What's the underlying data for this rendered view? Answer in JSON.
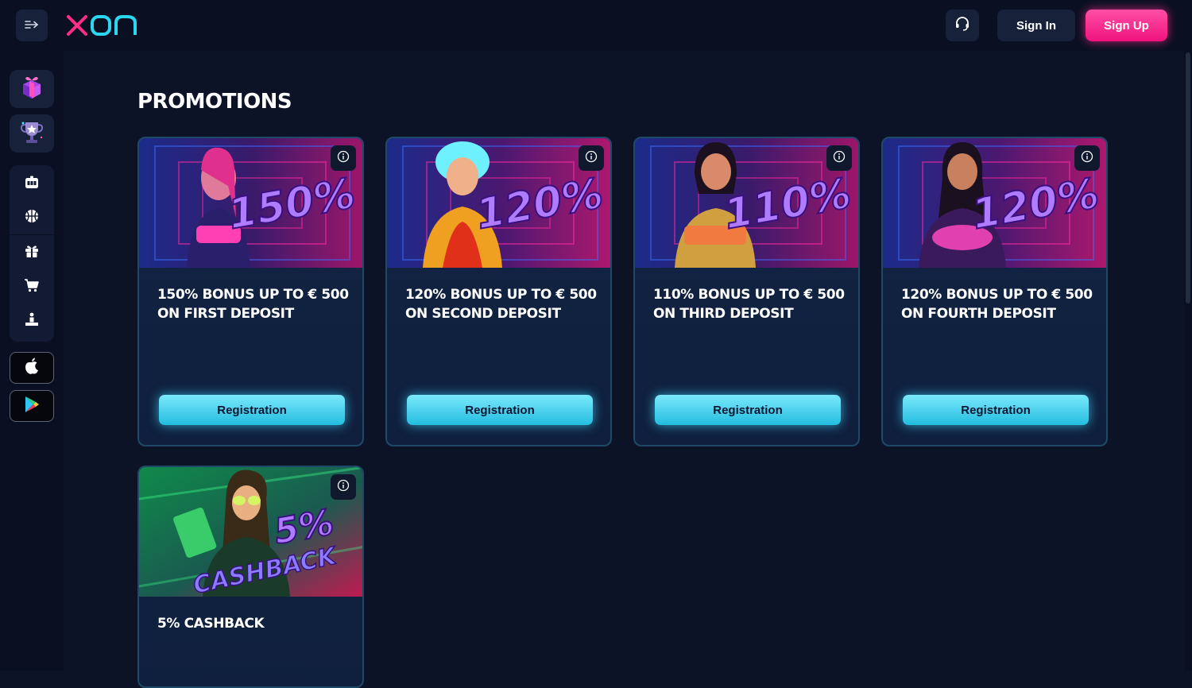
{
  "header": {
    "logo_text": "xon",
    "menu_icon": "expand-menu-icon",
    "support_icon": "headset-icon",
    "signin_label": "Sign In",
    "signup_label": "Sign Up"
  },
  "sidebar": {
    "featured": [
      {
        "name": "promotions",
        "icon": "gift-box-icon"
      },
      {
        "name": "tournaments",
        "icon": "trophy-icon"
      }
    ],
    "items": [
      {
        "name": "casino",
        "icon": "slot-machine-icon"
      },
      {
        "name": "sports",
        "icon": "basketball-icon"
      },
      {
        "name": "bonuses",
        "icon": "gift-icon"
      },
      {
        "name": "shop",
        "icon": "cart-icon"
      },
      {
        "name": "vip",
        "icon": "podium-icon"
      }
    ],
    "apps": [
      {
        "name": "ios",
        "icon": "apple-icon"
      },
      {
        "name": "android",
        "icon": "google-play-icon"
      }
    ]
  },
  "main": {
    "title": "PROMOTIONS",
    "cards": [
      {
        "title": "150% BONUS UP TO € 500 ON FIRST DEPOSIT",
        "banner_text": "150%",
        "button_label": "Registration"
      },
      {
        "title": "120% BONUS UP TO € 500 ON SECOND DEPOSIT",
        "banner_text": "120%",
        "button_label": "Registration"
      },
      {
        "title": "110% BONUS UP TO € 500 ON THIRD DEPOSIT",
        "banner_text": "110%",
        "button_label": "Registration"
      },
      {
        "title": "120% BONUS UP TO € 500 ON FOURTH DEPOSIT",
        "banner_text": "120%",
        "button_label": "Registration"
      },
      {
        "title": "5% CASHBACK",
        "banner_text": "5%",
        "banner_text_2": "CASHBACK"
      }
    ]
  },
  "colors": {
    "background": "#0c1327",
    "accent_pink": "#f0137e",
    "accent_cyan": "#22bde0",
    "card_border": "#1e4a68"
  }
}
